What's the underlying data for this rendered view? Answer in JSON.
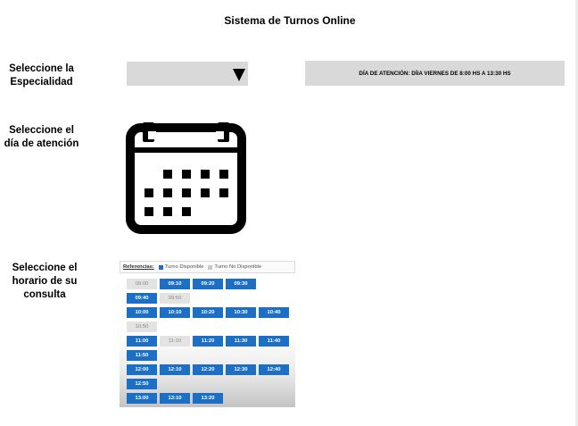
{
  "page": {
    "title": "Sistema de Turnos Online"
  },
  "labels": {
    "especialidad_l1": "Seleccione la",
    "especialidad_l2": "Especialidad",
    "dia_l1": "Seleccione el",
    "dia_l2": "día de atención",
    "horario_l1": "Seleccione el",
    "horario_l2": "horario de su",
    "horario_l3": "consulta"
  },
  "especialidad_select": {
    "value": "",
    "icon": "triangle-down-icon"
  },
  "info_bar": {
    "text": "DÍA DE ATENCIÓN:  DÍIA VIERNES DE 8:00 HS A 13:30 HS"
  },
  "calendar": {
    "icon": "calendar-icon",
    "color": "#000000"
  },
  "schedule": {
    "legend": {
      "title": "Referencias:",
      "available": "Turno Disponible",
      "unavailable": "Turno No Disponible"
    },
    "colors": {
      "available": "#1c6fc4",
      "unavailable": "#e3e3e3"
    },
    "rows": [
      [
        {
          "time": "09:00",
          "available": false
        },
        {
          "time": "09:10",
          "available": true
        },
        {
          "time": "09:20",
          "available": true
        },
        {
          "time": "09:30",
          "available": true
        }
      ],
      [
        {
          "time": "09:40",
          "available": true
        },
        {
          "time": "09:50",
          "available": false
        }
      ],
      [
        {
          "time": "10:00",
          "available": true
        },
        {
          "time": "10:10",
          "available": true
        },
        {
          "time": "10:20",
          "available": true
        },
        {
          "time": "10:30",
          "available": true
        },
        {
          "time": "10:40",
          "available": true
        }
      ],
      [
        {
          "time": "10:50",
          "available": false
        }
      ],
      [
        {
          "time": "11:00",
          "available": true
        },
        {
          "time": "11:10",
          "available": false
        },
        {
          "time": "11:20",
          "available": true
        },
        {
          "time": "11:30",
          "available": true
        },
        {
          "time": "11:40",
          "available": true
        }
      ],
      [
        {
          "time": "11:50",
          "available": true
        }
      ],
      [
        {
          "time": "12:00",
          "available": true
        },
        {
          "time": "12:10",
          "available": true
        },
        {
          "time": "12:20",
          "available": true
        },
        {
          "time": "12:30",
          "available": true
        },
        {
          "time": "12:40",
          "available": true
        }
      ],
      [
        {
          "time": "12:50",
          "available": true
        }
      ],
      [
        {
          "time": "13:00",
          "available": true
        },
        {
          "time": "13:10",
          "available": true
        },
        {
          "time": "13:20",
          "available": true
        }
      ]
    ]
  }
}
